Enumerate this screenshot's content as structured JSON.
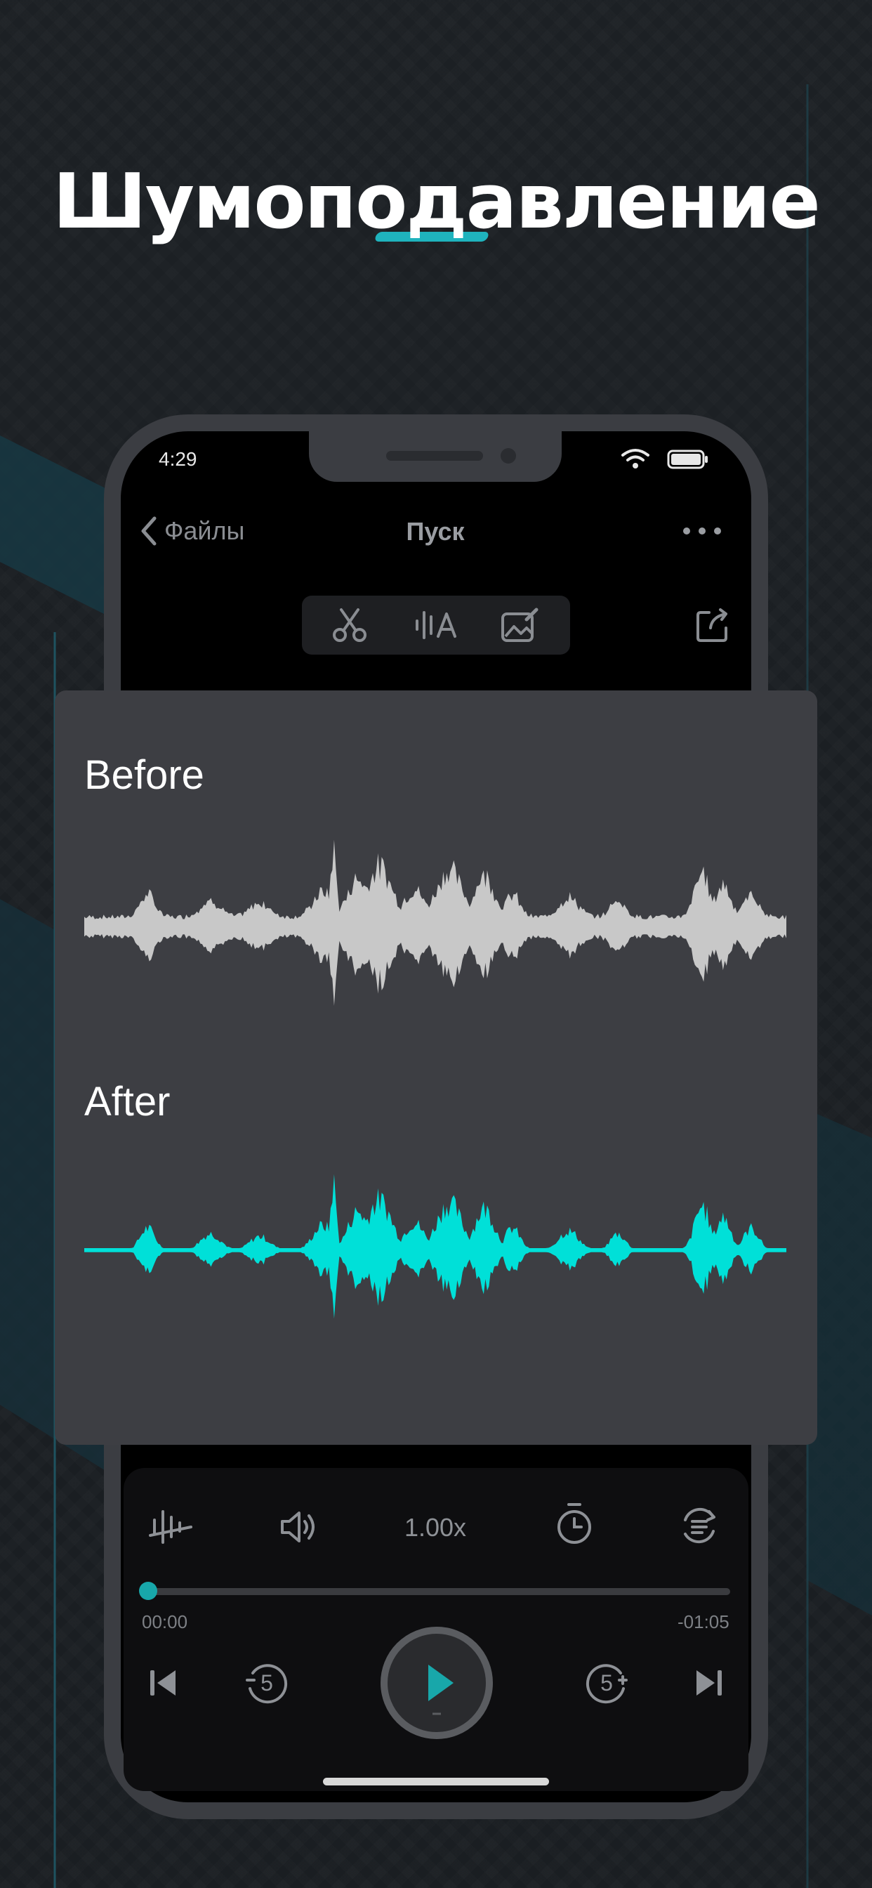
{
  "headline": "Шумоподавление",
  "status_bar": {
    "time": "4:29"
  },
  "nav": {
    "back_label": "Файлы",
    "title": "Пуск"
  },
  "comparison": {
    "before_label": "Before",
    "after_label": "After"
  },
  "player": {
    "speed": "1.00x",
    "current_time": "00:00",
    "remaining_time": "-01:05",
    "rewind_seconds": "5",
    "forward_seconds": "5",
    "progress": 0
  },
  "colors": {
    "accent": "#18a7aa",
    "waveform_before": "#c8c8c8",
    "waveform_after": "#00e0d8"
  },
  "icons": [
    "chevron-left-icon",
    "more-icon",
    "wifi-icon",
    "battery-icon",
    "scissors-icon",
    "waveform-text-icon",
    "edit-image-icon",
    "share-icon",
    "noise-reduction-icon",
    "speaker-icon",
    "timer-icon",
    "repeat-icon",
    "skip-back-icon",
    "rewind-5-icon",
    "play-icon",
    "forward-5-icon",
    "skip-forward-icon"
  ]
}
